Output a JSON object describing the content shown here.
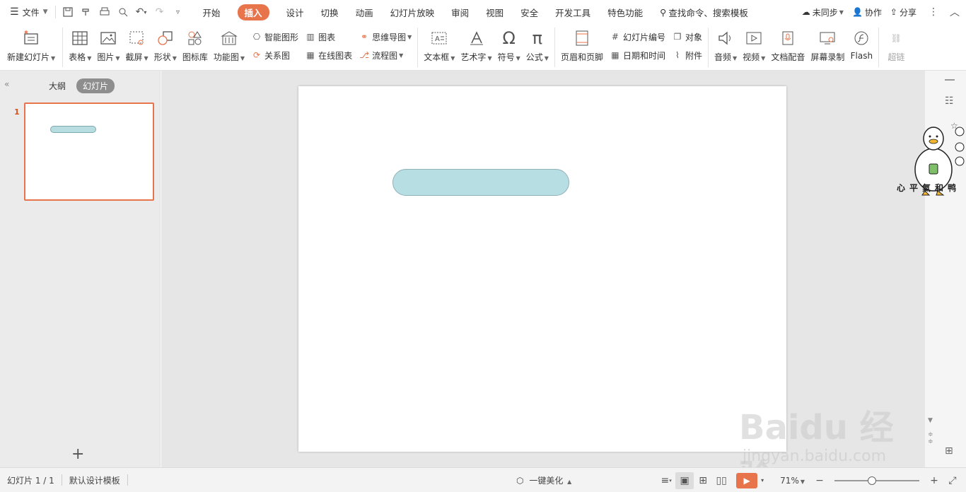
{
  "menubar": {
    "file_label": "文件",
    "tabs": [
      {
        "label": "开始"
      },
      {
        "label": "插入"
      },
      {
        "label": "设计"
      },
      {
        "label": "切换"
      },
      {
        "label": "动画"
      },
      {
        "label": "幻灯片放映"
      },
      {
        "label": "审阅"
      },
      {
        "label": "视图"
      },
      {
        "label": "安全"
      },
      {
        "label": "开发工具"
      },
      {
        "label": "特色功能"
      }
    ],
    "active_tab": "插入",
    "search_label": "查找命令、搜索模板",
    "sync_label": "未同步",
    "collab_label": "协作",
    "share_label": "分享"
  },
  "ribbon": {
    "new_slide": "新建幻灯片",
    "table": "表格",
    "picture": "图片",
    "screenshot": "截屏",
    "shape": "形状",
    "icon_lib": "图标库",
    "func_chart": "功能图",
    "smart_shape": "智能图形",
    "chart": "图表",
    "relation": "关系图",
    "online_chart": "在线图表",
    "mindmap": "思维导图",
    "flowchart": "流程图",
    "textbox": "文本框",
    "wordart": "艺术字",
    "symbol": "符号",
    "formula": "公式",
    "header_footer": "页眉和页脚",
    "slide_number": "幻灯片编号",
    "object": "对象",
    "date_time": "日期和时间",
    "attachment": "附件",
    "audio": "音频",
    "video": "视频",
    "doc_dub": "文档配音",
    "screen_record": "屏幕录制",
    "flash": "Flash",
    "hyperlink": "超链"
  },
  "leftpanel": {
    "tab_outline": "大纲",
    "tab_slides": "幻灯片",
    "slide_number": "1"
  },
  "rightbar": {
    "duck_caption": "心平氣和鸭"
  },
  "statusbar": {
    "slide_info": "幻灯片 1 / 1",
    "template": "默认设计模板",
    "beautify": "一键美化",
    "zoom": "71%",
    "zoom_fraction": 0.71
  },
  "watermark": {
    "logo": "Baidu 经验",
    "url": "jingyan.baidu.com"
  },
  "colors": {
    "accent": "#e8744c",
    "shape_fill": "#b7dee2",
    "shape_border": "#8fb2b7"
  }
}
